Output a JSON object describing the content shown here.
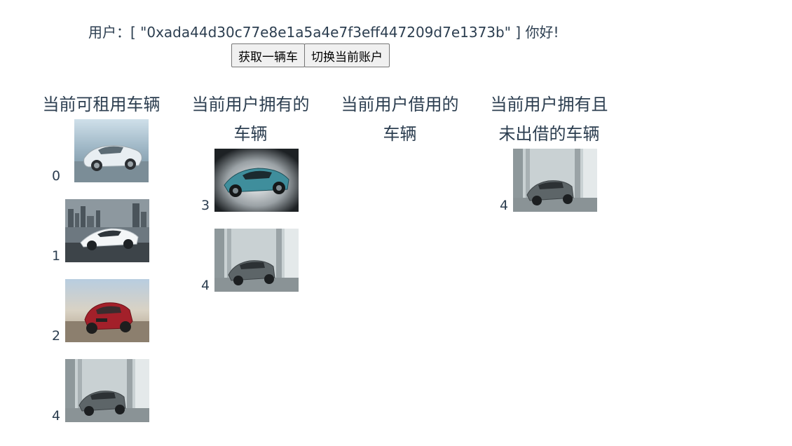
{
  "header": {
    "greeting": "用户：[ \"0xada44d30c77e8e1a5a4e7f3eff447209d7e1373b\" ] 你好!",
    "get_car_button": "获取一辆车",
    "switch_account_button": "切换当前账户"
  },
  "columns": [
    {
      "title": "当前可租用车辆",
      "cars": [
        {
          "id": "0",
          "image": "silver-porsche-panamera"
        },
        {
          "id": "1",
          "image": "white-lamborghini-city"
        },
        {
          "id": "2",
          "image": "red-bmw-x4"
        },
        {
          "id": "4",
          "image": "gray-bentley-garage"
        }
      ]
    },
    {
      "title": "当前用户拥有的车辆",
      "title_line1": "当前用户拥有的",
      "title_line2": "车辆",
      "cars": [
        {
          "id": "3",
          "image": "blue-aston-martin-studio"
        },
        {
          "id": "4",
          "image": "gray-bentley-garage"
        }
      ]
    },
    {
      "title": "当前用户借用的车辆",
      "title_line1": "当前用户借用的",
      "title_line2": "车辆",
      "cars": []
    },
    {
      "title": "当前用户拥有且未出借的车辆",
      "title_line1": "当前用户拥有且",
      "title_line2": "未出借的车辆",
      "cars": [
        {
          "id": "4",
          "image": "gray-bentley-garage"
        }
      ]
    }
  ]
}
